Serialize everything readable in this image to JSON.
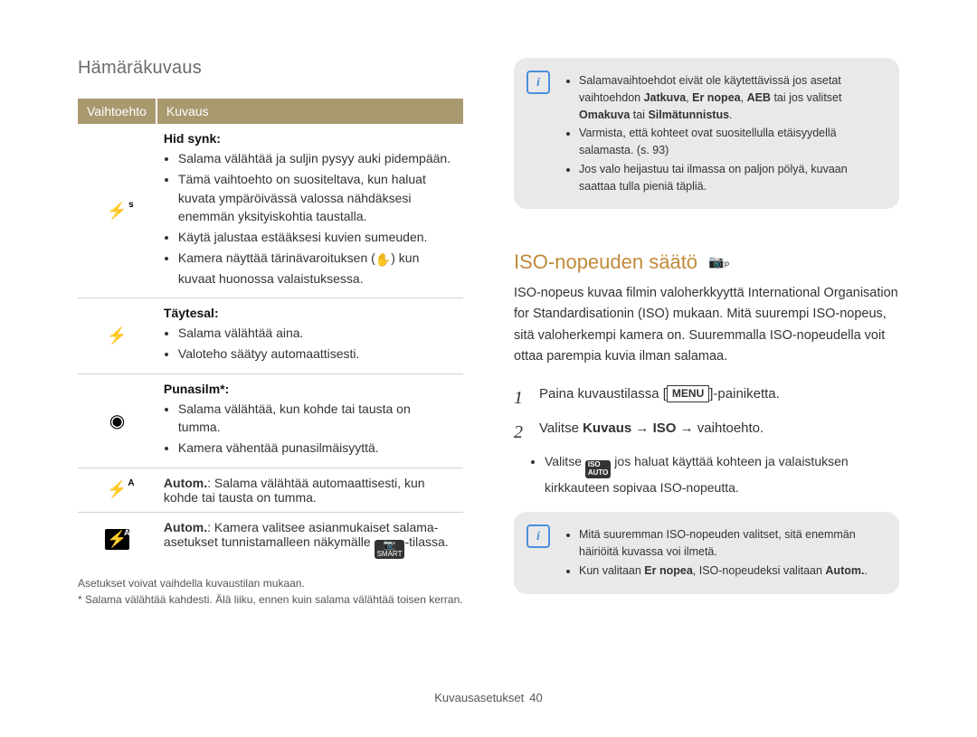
{
  "chapter_title": "Hämäräkuvaus",
  "table": {
    "col_option": "Vaihtoehto",
    "col_desc": "Kuvaus",
    "rows": [
      {
        "icon_name": "flash-slow-sync-icon",
        "title": "Hid synk",
        "title_colon": ":",
        "bullets": [
          "Salama välähtää ja suljin pysyy auki pidempään.",
          "Tämä vaihtoehto on suositeltava, kun haluat kuvata ympäröivässä valossa nähdäksesi enemmän yksityiskohtia taustalla.",
          "Käytä jalustaa estääksesi kuvien sumeuden."
        ],
        "last_bullet_pre": "Kamera näyttää tärinävaroituksen (",
        "last_bullet_icon": "hand-shake-icon",
        "last_bullet_post": ") kun kuvaat huonossa valaistuksessa."
      },
      {
        "icon_name": "flash-fill-icon",
        "title": "Täytesal",
        "title_colon": ":",
        "bullets": [
          "Salama välähtää aina.",
          "Valoteho säätyy automaattisesti."
        ]
      },
      {
        "icon_name": "red-eye-icon",
        "title": "Punasilm*",
        "title_colon": ":",
        "bullets": [
          "Salama välähtää, kun kohde tai tausta on tumma.",
          "Kamera vähentää punasilmäisyyttä."
        ]
      },
      {
        "icon_name": "flash-auto-icon",
        "title": "Autom.",
        "title_colon": ":",
        "inline_text": " Salama välähtää automaattisesti, kun kohde tai tausta on tumma."
      },
      {
        "icon_name": "flash-auto-smart-icon",
        "title": "Autom.",
        "title_colon": ":",
        "inline_pre": " Kamera valitsee asianmukaiset salama-asetukset tunnistamalleen näkymälle ",
        "inline_icon": "smart-auto-icon",
        "inline_post": "-tilassa."
      }
    ]
  },
  "small_notes": {
    "n1": "Asetukset voivat vaihdella kuvaustilan mukaan.",
    "n2": "* Salama välähtää kahdesti. Älä liiku, ennen kuin salama välähtää toisen kerran."
  },
  "note1": {
    "b1_pre": "Salamavaihtoehdot eivät ole käytettävissä jos asetat vaihtoehdon ",
    "b1_bold1": "Jatkuva",
    "b1_mid1": ", ",
    "b1_bold2": "Er nopea",
    "b1_mid2": ", ",
    "b1_bold3": "AEB",
    "b1_mid3": " tai jos valitset ",
    "b1_bold4": "Omakuva",
    "b1_mid4": " tai ",
    "b1_bold5": "Silmätunnistus",
    "b1_end": ".",
    "b2": "Varmista, että kohteet ovat suositellulla etäisyydellä salamasta. (s. 93)",
    "b3": "Jos valo heijastuu tai ilmassa on paljon pölyä, kuvaan saattaa tulla pieniä täpliä."
  },
  "section_title": "ISO-nopeuden säätö",
  "iso_paragraph": "ISO-nopeus kuvaa filmin valoherkkyyttä International Organisation for Standardisationin (ISO) mukaan. Mitä suurempi ISO-nopeus, sitä valoherkempi kamera on. Suuremmalla ISO-nopeudella voit ottaa parempia kuvia ilman salamaa.",
  "step1": {
    "num": "1",
    "pre": "Paina kuvaustilassa [",
    "kbd": "MENU",
    "post": "]-painiketta."
  },
  "step2": {
    "num": "2",
    "pre": "Valitse ",
    "b1": "Kuvaus",
    "arrow1": " → ",
    "b2": "ISO",
    "arrow2": " → ",
    "tail": "vaihtoehto."
  },
  "step2_sub": {
    "pre": "Valitse ",
    "icon": "iso-auto-icon",
    "post": " jos haluat käyttää kohteen ja valaistuksen kirkkauteen sopivaa ISO-nopeutta."
  },
  "note2": {
    "b1": "Mitä suuremman ISO-nopeuden valitset, sitä enemmän häiriöitä kuvassa voi ilmetä.",
    "b2_pre": "Kun valitaan ",
    "b2_bold1": "Er nopea",
    "b2_mid": ", ISO-nopeudeksi valitaan ",
    "b2_bold2": "Autom.",
    "b2_end": "."
  },
  "footer": {
    "section": "Kuvausasetukset",
    "page": "40"
  }
}
